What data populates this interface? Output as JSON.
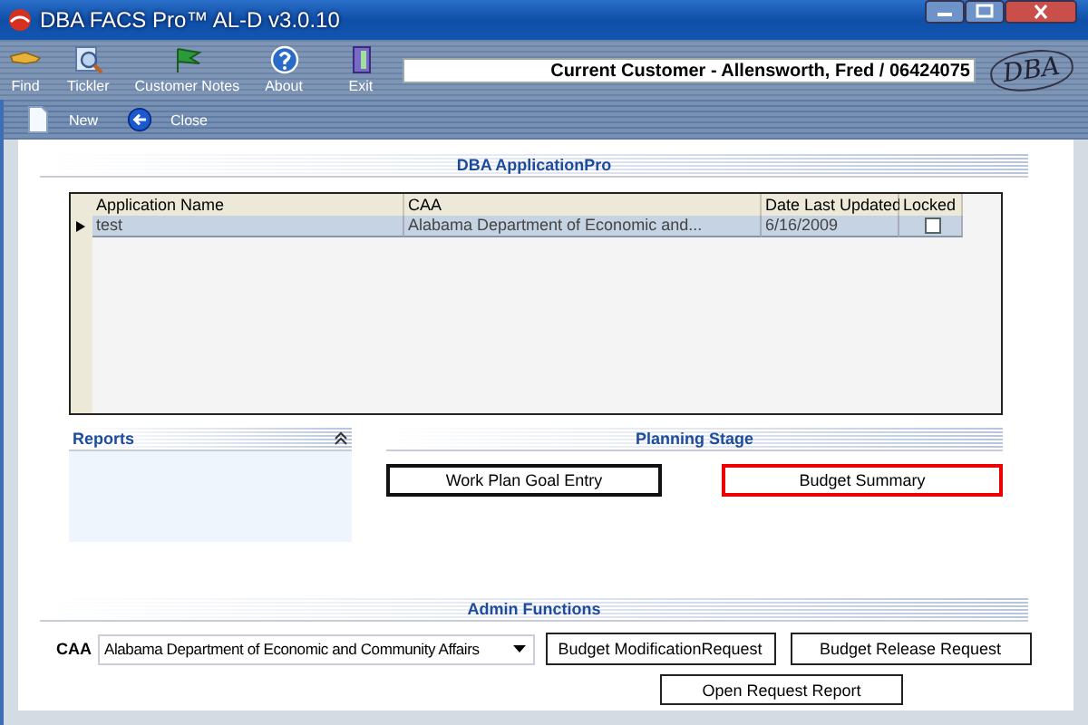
{
  "window": {
    "title": "DBA FACS Pro™ AL-D v3.0.10"
  },
  "toolbar": {
    "items": [
      {
        "kind": "find",
        "label": "Find"
      },
      {
        "kind": "tickler",
        "label": "Tickler"
      },
      {
        "kind": "notes",
        "label": "Customer Notes"
      },
      {
        "kind": "about",
        "label": "About"
      },
      {
        "kind": "exit",
        "label": "Exit"
      }
    ],
    "customer": "Current Customer - Allensworth, Fred / 06424075",
    "logo": "DBA"
  },
  "subtoolbar": {
    "items": [
      {
        "kind": "new",
        "label": "New"
      },
      {
        "kind": "close",
        "label": "Close"
      }
    ]
  },
  "application_section": {
    "title": "DBA ApplicationPro",
    "table": {
      "columns": [
        "Application Name",
        "CAA",
        "Date Last Updated",
        "Locked"
      ],
      "rows": [
        {
          "selected": true,
          "cells": [
            "test",
            "Alabama Department of Economic and...",
            "6/16/2009"
          ],
          "locked": false
        }
      ]
    }
  },
  "reports": {
    "title": "Reports"
  },
  "planning_stage": {
    "title": "Planning Stage",
    "buttons": [
      {
        "label": "Work Plan Goal Entry",
        "selected": false
      },
      {
        "label": "Budget Summary",
        "selected": true
      }
    ]
  },
  "admin_functions": {
    "title": "Admin Functions",
    "caa_label": "CAA",
    "caa_value": "Alabama Department of Economic and Community Affairs",
    "buttons": [
      "Budget ModificationRequest",
      "Budget Release Request",
      "Open Request Report"
    ]
  }
}
